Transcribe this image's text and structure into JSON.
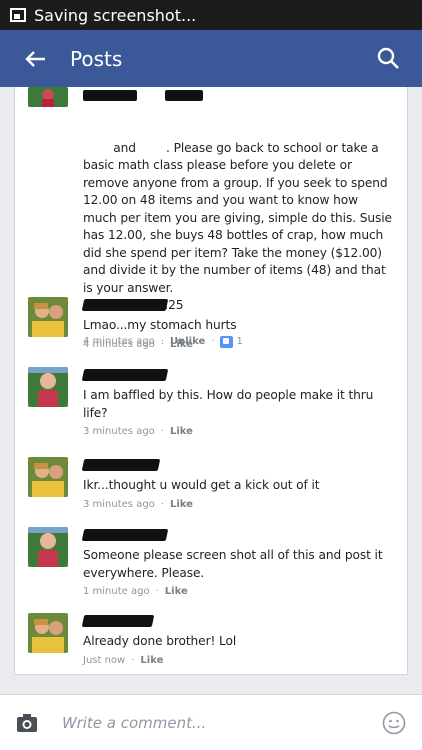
{
  "status": {
    "text": "Saving screenshot..."
  },
  "header": {
    "title": "Posts"
  },
  "composer": {
    "placeholder": "Write a comment..."
  },
  "comments": [
    {
      "name_prefix": "",
      "text": "and        . Please go back to school or take a basic math class please before you delete or remove anyone from a group. If you seek to spend 12.00 on 48 items and you want to know how much per item you are giving, simple do this. Susie has 12.00, she buys 48 bottles of crap, how much did she spend per item? Take the money ($12.00) and divide it by the number of items (48) and that is your answer.\n$12.00÷48= .25",
      "time": "4 minutes ago",
      "action": "Unlike",
      "likes": "1"
    },
    {
      "text": "Lmao...my stomach hurts",
      "time": "4 minutes ago",
      "action": "Like"
    },
    {
      "text": "I am baffled by this. How do people make it thru life?",
      "time": "3 minutes ago",
      "action": "Like"
    },
    {
      "text": "Ikr...thought u would get a kick out of it",
      "time": "3 minutes ago",
      "action": "Like"
    },
    {
      "text": "Someone please screen shot all of this and post it everywhere. Please.",
      "time": "1 minute ago",
      "action": "Like"
    },
    {
      "text": "Already done brother! Lol",
      "time": "Just now",
      "action": "Like"
    }
  ],
  "colors": {
    "accent": "#3b5998",
    "statusbar": "#1c1c1c",
    "like": "#5890ff"
  }
}
